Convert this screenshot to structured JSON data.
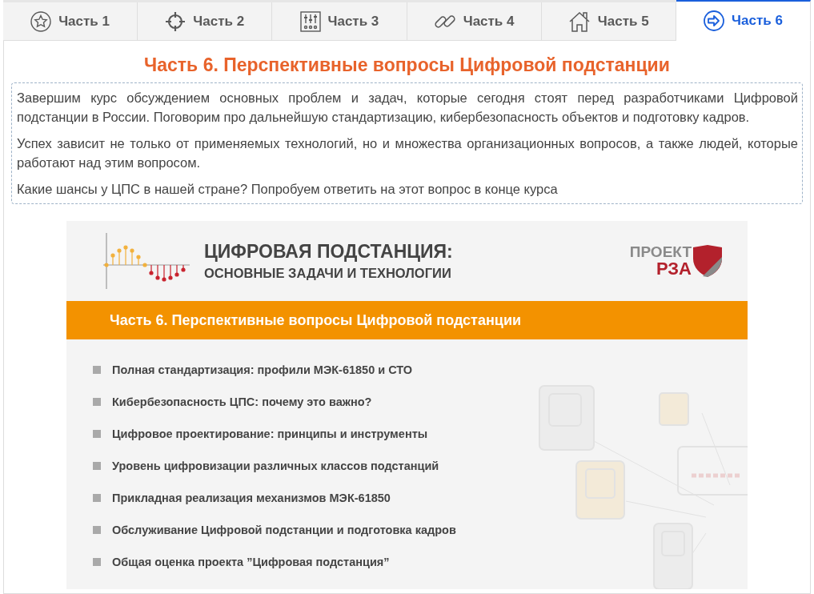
{
  "tabs": [
    {
      "label": "Часть 1",
      "selected": false
    },
    {
      "label": "Часть 2",
      "selected": false
    },
    {
      "label": "Часть 3",
      "selected": false
    },
    {
      "label": "Часть 4",
      "selected": false
    },
    {
      "label": "Часть 5",
      "selected": false
    },
    {
      "label": "Часть 6",
      "selected": true
    }
  ],
  "heading": "Часть 6. Перспективные вопросы Цифровой подстанции",
  "intro": {
    "paragraphs": [
      "Завершим курс обсуждением основных проблем и задач, которые сегодня стоят перед разработчиками Цифровой подстанции в России. Поговорим про дальнейшую стандартизацию, кибербезопасность объектов и подготовку кадров.",
      "Успех зависит не только от применяемых технологий, но и множества организационных вопросов, а также людей, которые работают над этим вопросом.",
      "Какие шансы у ЦПС в нашей стране? Попробуем ответить на этот вопрос в конце курса"
    ]
  },
  "slide": {
    "title": "ЦИФРОВАЯ ПОДСТАНЦИЯ:",
    "subtitle": "ОСНОВНЫЕ ЗАДАЧИ И ТЕХНОЛОГИИ",
    "logo": {
      "line_1": "ПРОЕКТ",
      "line_2": "РЗА"
    },
    "band": "Часть 6. Перспективные вопросы Цифровой подстанции",
    "items": [
      "Полная стандартизация: профили МЭК-61850 и СТО",
      "Кибербезопасность ЦПС: почему это важно?",
      "Цифровое проектирование: принципы и инструменты",
      "Уровень цифровизации различных классов подстанций",
      "Прикладная реализация механизмов МЭК-61850",
      "Обслуживание Цифровой подстанции и подготовка кадров",
      "Общая оценка проекта ”Цифровая подстанция”"
    ]
  }
}
